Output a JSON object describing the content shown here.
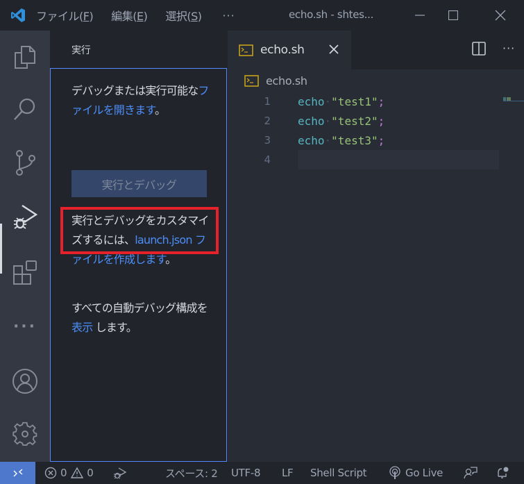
{
  "titlebar": {
    "menu": [
      {
        "label": "ファイル(",
        "mnemonic": "F",
        "suffix": ")"
      },
      {
        "label": "編集(",
        "mnemonic": "E",
        "suffix": ")"
      },
      {
        "label": "選択(",
        "mnemonic": "S",
        "suffix": ")"
      }
    ],
    "more": "···",
    "window_title": "echo.sh - shtes..."
  },
  "activitybar": {
    "items": [
      {
        "name": "explorer",
        "icon": "files-icon"
      },
      {
        "name": "search",
        "icon": "search-icon"
      },
      {
        "name": "source-control",
        "icon": "source-control-icon"
      },
      {
        "name": "run-debug",
        "icon": "run-debug-icon",
        "active": true
      },
      {
        "name": "extensions",
        "icon": "extensions-icon"
      },
      {
        "name": "more",
        "icon": "more-icon"
      },
      {
        "name": "accounts",
        "icon": "account-icon"
      },
      {
        "name": "manage",
        "icon": "gear-icon"
      }
    ],
    "more_label": "···"
  },
  "sidebar": {
    "title": "実行",
    "para1_text": "デバッグまたは実行可能な",
    "para1_link": "ファイルを開きます",
    "para1_end": "。",
    "run_debug_button": "実行とデバッグ",
    "para2_text": "実行とデバッグをカスタマイズするには、",
    "para2_link": "launch.json ファイルを作成します",
    "para2_end": "。",
    "para3_text": "すべての自動デバッグ構成を ",
    "para3_link": "表示",
    "para3_end": " します。"
  },
  "editor": {
    "tab_label": "echo.sh",
    "breadcrumb": "echo.sh",
    "lines": [
      {
        "num": "1",
        "kw": "echo",
        "str": "\"test1\"",
        "end": ";"
      },
      {
        "num": "2",
        "kw": "echo",
        "str": "\"test2\"",
        "end": ";"
      },
      {
        "num": "3",
        "kw": "echo",
        "str": "\"test3\"",
        "end": ";"
      },
      {
        "num": "4",
        "kw": "",
        "str": "",
        "end": ""
      }
    ],
    "ws_dot": "·"
  },
  "statusbar": {
    "errors": "0",
    "warnings": "0",
    "indent": "スペース: 2",
    "encoding": "UTF-8",
    "eol": "LF",
    "language": "Shell Script",
    "go_live": "Go Live"
  },
  "colors": {
    "accent": "#528bff",
    "link": "#4d8df7",
    "remote": "#4d78cc",
    "highlight": "#e5212a"
  }
}
